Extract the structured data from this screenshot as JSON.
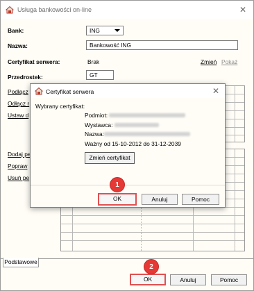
{
  "window": {
    "title": "Usługa bankowości on-line",
    "close_symbol": "✕"
  },
  "form": {
    "bank_label": "Bank:",
    "bank_value": "ING",
    "name_label": "Nazwa:",
    "name_value": "Bankowość ING",
    "cert_label": "Certyfikat serwera:",
    "cert_value": "Brak",
    "cert_change_link": "Zmień",
    "cert_show_link": "Pokaż",
    "prefix_label": "Przedrostek:",
    "prefix_value": "GT"
  },
  "side_links_top": [
    "Podłącz",
    "Odłącz r",
    "Ustaw d"
  ],
  "side_links_bottom": [
    "Dodaj pe",
    "Popraw",
    "Usuń pe"
  ],
  "tabs": [
    "Podstawowe"
  ],
  "main_buttons": {
    "ok": "OK",
    "cancel": "Anuluj",
    "help": "Pomoc"
  },
  "dialog": {
    "title": "Certyfikat serwera",
    "selected_label": "Wybrany certyfikat:",
    "subject_label": "Podmiot:",
    "issuer_label": "Wystawca:",
    "name_label": "Nazwa:",
    "validity": "Ważny od 15-10-2012 do 31-12-2039",
    "change_button": "Zmień certyfikat",
    "ok": "OK",
    "cancel": "Anuluj",
    "help": "Pomoc"
  },
  "badges": {
    "step1": "1",
    "step2": "2"
  },
  "colors": {
    "badge": "#e53935",
    "highlight_border": "#e05050",
    "window_bg": "#fffdf6"
  },
  "icons": {
    "app": "app-logo-icon",
    "close": "close-icon",
    "dropdown": "chevron-down-icon"
  }
}
